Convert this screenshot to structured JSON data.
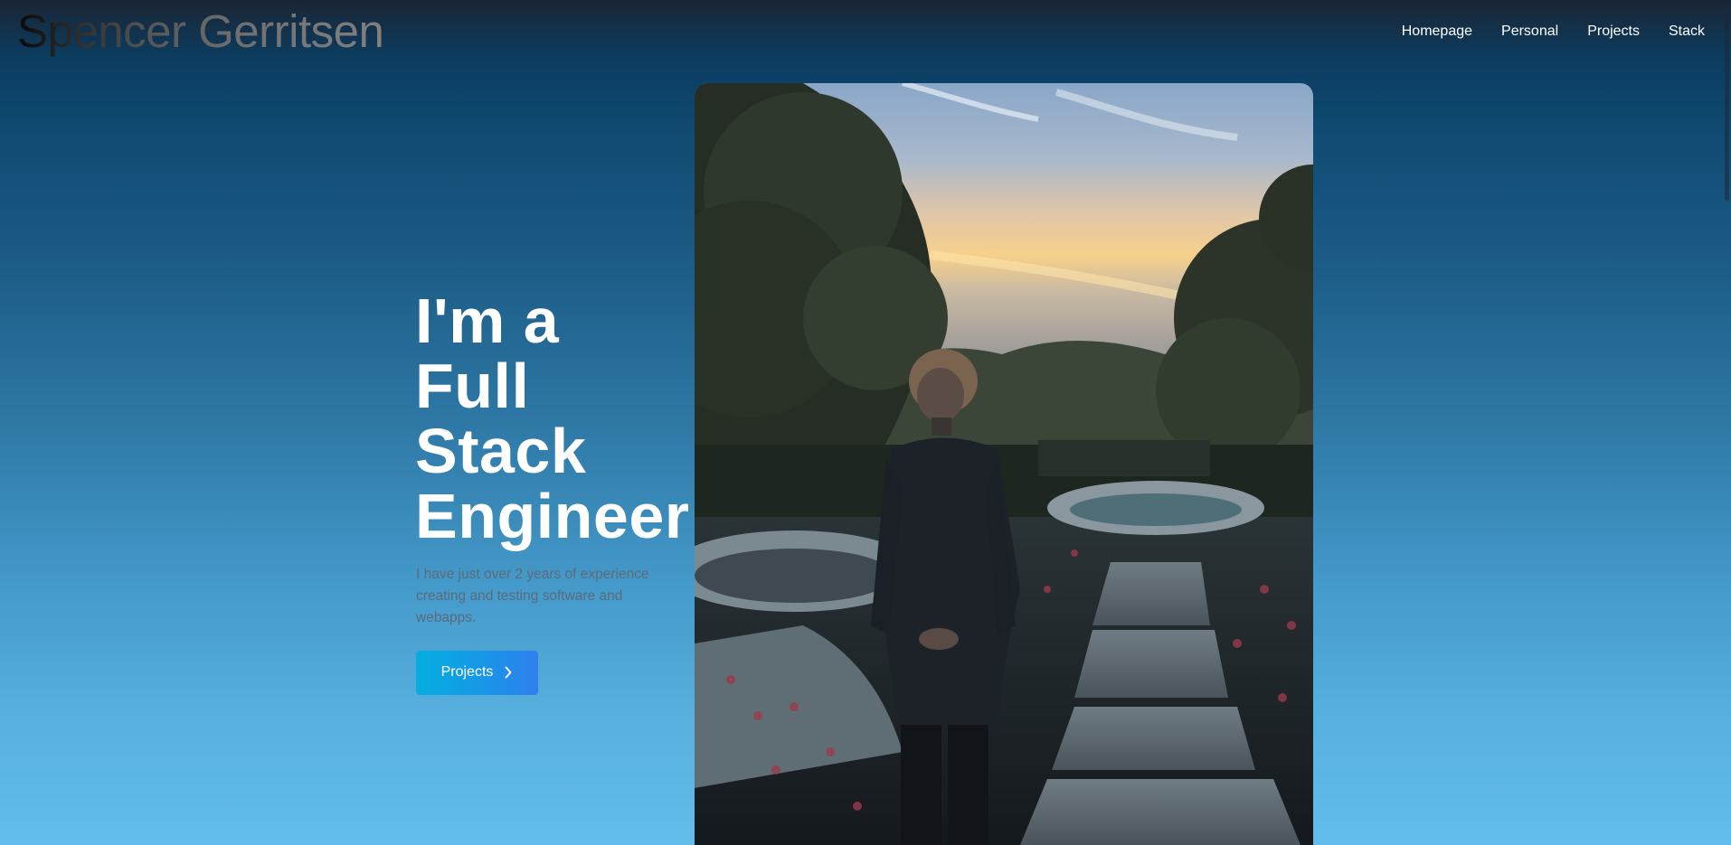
{
  "header": {
    "brand": "Spencer Gerritsen",
    "nav": [
      {
        "label": "Homepage"
      },
      {
        "label": "Personal"
      },
      {
        "label": "Projects"
      },
      {
        "label": "Stack"
      }
    ]
  },
  "hero": {
    "title_lines": [
      "I'm a",
      "Full",
      "Stack",
      "Engineer"
    ],
    "description": "I have just over 2 years of experience creating and testing software and webapps.",
    "cta_label": "Projects",
    "cta_icon": "chevron-right-icon"
  },
  "photo": {
    "subject": "portrait-photo"
  },
  "colors": {
    "button_gradient_start": "#05aee0",
    "button_gradient_end": "#2f80ee",
    "description_text": "#5c6b7a",
    "nav_text": "#ffffff"
  }
}
